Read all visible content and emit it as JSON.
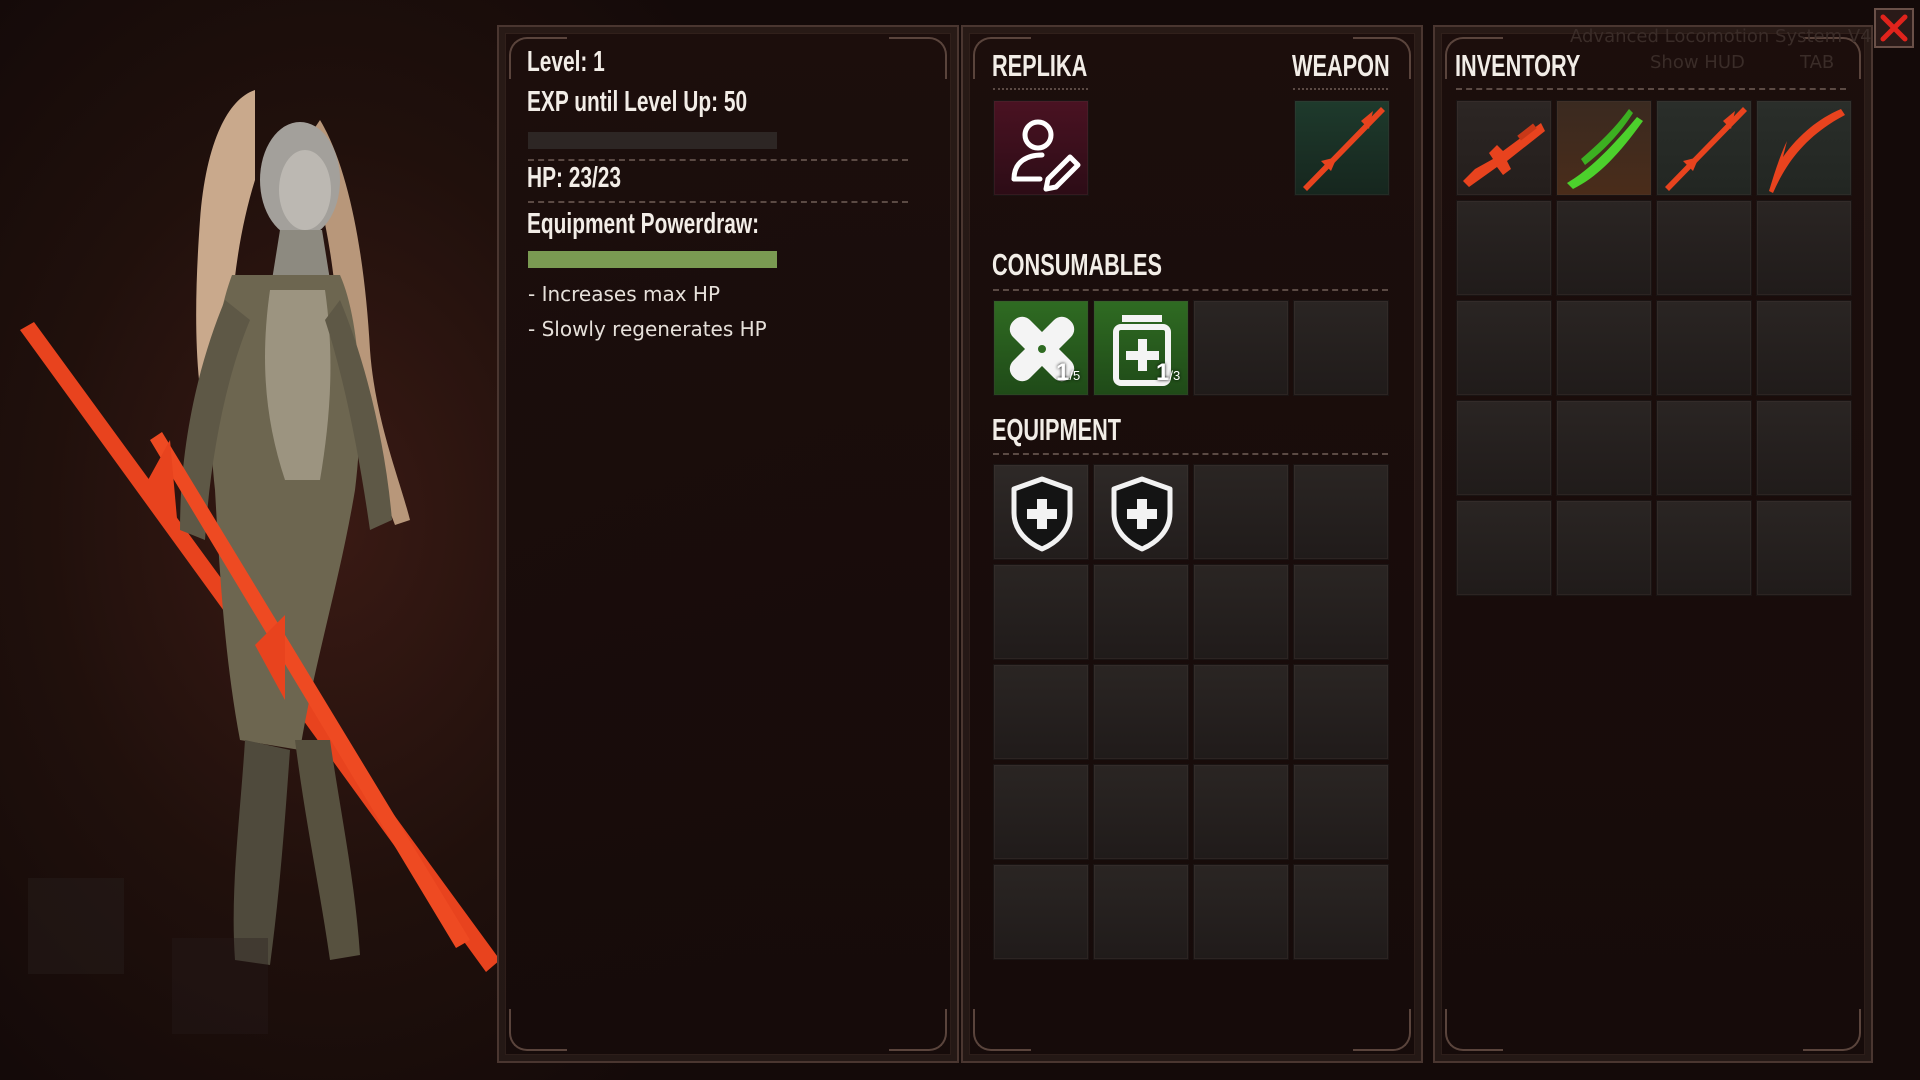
{
  "stats": {
    "level": "Level: 1",
    "exp": "EXP until Level Up: 50",
    "exp_progress": 0,
    "hp": "HP: 23/23",
    "powerdraw_label": "Equipment Powerdraw:",
    "powerdraw_progress": 1.0,
    "bullets": [
      "- Increases max HP",
      "- Slowly regenerates HP"
    ]
  },
  "replika": {
    "title": "REPLIKA",
    "icon": "user-edit-icon"
  },
  "weapon": {
    "title": "WEAPON",
    "icon": "spear-icon"
  },
  "consumables": {
    "title": "CONSUMABLES",
    "items": [
      {
        "icon": "bandage-icon",
        "count": "1",
        "max": "/5"
      },
      {
        "icon": "medkit-icon",
        "count": "1",
        "max": "/3"
      }
    ]
  },
  "equipment": {
    "title": "EQUIPMENT",
    "items": [
      {
        "icon": "shield-plus-icon"
      },
      {
        "icon": "shield-plus-icon"
      }
    ]
  },
  "inventory": {
    "title": "INVENTORY",
    "items": [
      {
        "icon": "rifle-icon"
      },
      {
        "icon": "green-blade-icon"
      },
      {
        "icon": "spear-icon"
      },
      {
        "icon": "scythe-icon"
      }
    ]
  },
  "background_hints": [
    "Advanced Locomotion System V4",
    "Show HUD",
    "TAB"
  ],
  "colors": {
    "accent_orange": "#e8431e",
    "hp_bar_green": "#7a9a52",
    "close_red": "#e0231c",
    "consumable_green": "#2f6b22"
  }
}
